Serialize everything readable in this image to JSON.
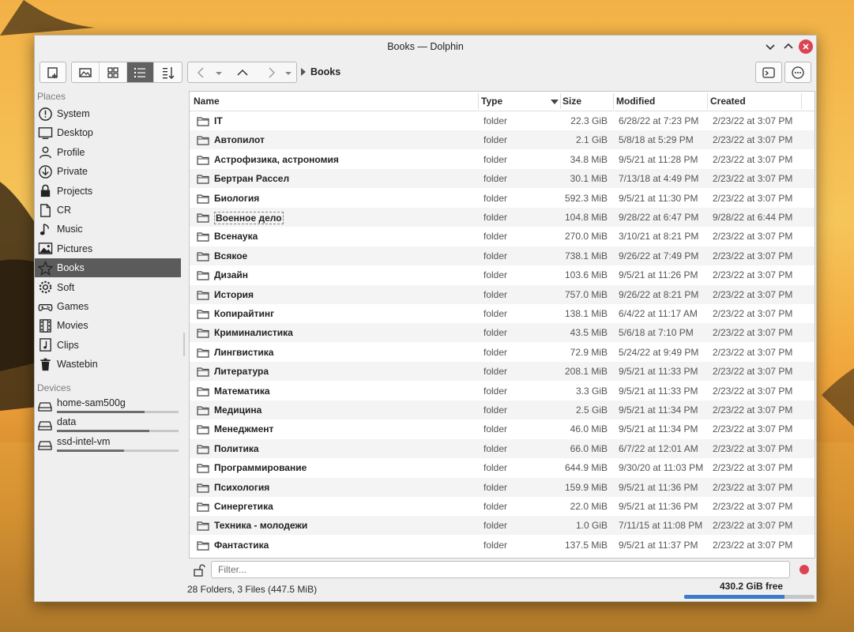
{
  "window": {
    "title": "Books — Dolphin"
  },
  "toolbar": {
    "breadcrumb": "Books",
    "icons": [
      "new-window-icon",
      "preview-icon",
      "icons-view-icon",
      "details-view-icon",
      "sort-icon",
      "back-icon",
      "history-icon",
      "up-icon",
      "forward-icon",
      "terminal-icon",
      "menu-icon"
    ]
  },
  "sidebar": {
    "places_title": "Places",
    "places": [
      {
        "label": "System",
        "icon": "info-icon"
      },
      {
        "label": "Desktop",
        "icon": "desktop-icon"
      },
      {
        "label": "Profile",
        "icon": "user-icon"
      },
      {
        "label": "Private",
        "icon": "download-icon"
      },
      {
        "label": "Projects",
        "icon": "lock-icon"
      },
      {
        "label": "CR",
        "icon": "document-icon"
      },
      {
        "label": "Music",
        "icon": "music-icon"
      },
      {
        "label": "Pictures",
        "icon": "picture-icon"
      },
      {
        "label": "Books",
        "icon": "star-icon",
        "selected": true
      },
      {
        "label": "Soft",
        "icon": "gear-icon"
      },
      {
        "label": "Games",
        "icon": "gamepad-icon"
      },
      {
        "label": "Movies",
        "icon": "film-icon"
      },
      {
        "label": "Clips",
        "icon": "clip-icon"
      },
      {
        "label": "Wastebin",
        "icon": "trash-icon"
      }
    ],
    "devices_title": "Devices",
    "devices": [
      {
        "label": "home-sam500g",
        "used_fraction": 0.72
      },
      {
        "label": "data",
        "used_fraction": 0.76
      },
      {
        "label": "ssd-intel-vm",
        "used_fraction": 0.55
      }
    ]
  },
  "columns": {
    "name": "Name",
    "type": "Type",
    "size": "Size",
    "modified": "Modified",
    "created": "Created"
  },
  "files": [
    {
      "name": "IT",
      "type": "folder",
      "size": "22.3 GiB",
      "modified": "6/28/22 at 7:23 PM",
      "created": "2/23/22 at 3:07 PM"
    },
    {
      "name": "Автопилот",
      "type": "folder",
      "size": "2.1 GiB",
      "modified": "5/8/18 at 5:29 PM",
      "created": "2/23/22 at 3:07 PM"
    },
    {
      "name": "Астрофизика, астрономия",
      "type": "folder",
      "size": "34.8 MiB",
      "modified": "9/5/21 at 11:28 PM",
      "created": "2/23/22 at 3:07 PM"
    },
    {
      "name": "Бертран Рассел",
      "type": "folder",
      "size": "30.1 MiB",
      "modified": "7/13/18 at 4:49 PM",
      "created": "2/23/22 at 3:07 PM"
    },
    {
      "name": "Биология",
      "type": "folder",
      "size": "592.3 MiB",
      "modified": "9/5/21 at 11:30 PM",
      "created": "2/23/22 at 3:07 PM"
    },
    {
      "name": "Военное дело",
      "type": "folder",
      "size": "104.8 MiB",
      "modified": "9/28/22 at 6:47 PM",
      "created": "9/28/22 at 6:44 PM",
      "focused": true
    },
    {
      "name": "Всенаука",
      "type": "folder",
      "size": "270.0 MiB",
      "modified": "3/10/21 at 8:21 PM",
      "created": "2/23/22 at 3:07 PM"
    },
    {
      "name": "Всякое",
      "type": "folder",
      "size": "738.1 MiB",
      "modified": "9/26/22 at 7:49 PM",
      "created": "2/23/22 at 3:07 PM"
    },
    {
      "name": "Дизайн",
      "type": "folder",
      "size": "103.6 MiB",
      "modified": "9/5/21 at 11:26 PM",
      "created": "2/23/22 at 3:07 PM"
    },
    {
      "name": "История",
      "type": "folder",
      "size": "757.0 MiB",
      "modified": "9/26/22 at 8:21 PM",
      "created": "2/23/22 at 3:07 PM"
    },
    {
      "name": "Копирайтинг",
      "type": "folder",
      "size": "138.1 MiB",
      "modified": "6/4/22 at 11:17 AM",
      "created": "2/23/22 at 3:07 PM"
    },
    {
      "name": "Криминалистика",
      "type": "folder",
      "size": "43.5 MiB",
      "modified": "5/6/18 at 7:10 PM",
      "created": "2/23/22 at 3:07 PM"
    },
    {
      "name": "Лингвистика",
      "type": "folder",
      "size": "72.9 MiB",
      "modified": "5/24/22 at 9:49 PM",
      "created": "2/23/22 at 3:07 PM"
    },
    {
      "name": "Литература",
      "type": "folder",
      "size": "208.1 MiB",
      "modified": "9/5/21 at 11:33 PM",
      "created": "2/23/22 at 3:07 PM"
    },
    {
      "name": "Математика",
      "type": "folder",
      "size": "3.3 GiB",
      "modified": "9/5/21 at 11:33 PM",
      "created": "2/23/22 at 3:07 PM"
    },
    {
      "name": "Медицина",
      "type": "folder",
      "size": "2.5 GiB",
      "modified": "9/5/21 at 11:34 PM",
      "created": "2/23/22 at 3:07 PM"
    },
    {
      "name": "Менеджмент",
      "type": "folder",
      "size": "46.0 MiB",
      "modified": "9/5/21 at 11:34 PM",
      "created": "2/23/22 at 3:07 PM"
    },
    {
      "name": "Политика",
      "type": "folder",
      "size": "66.0 MiB",
      "modified": "6/7/22 at 12:01 AM",
      "created": "2/23/22 at 3:07 PM"
    },
    {
      "name": "Программирование",
      "type": "folder",
      "size": "644.9 MiB",
      "modified": "9/30/20 at 11:03 PM",
      "created": "2/23/22 at 3:07 PM"
    },
    {
      "name": "Психология",
      "type": "folder",
      "size": "159.9 MiB",
      "modified": "9/5/21 at 11:36 PM",
      "created": "2/23/22 at 3:07 PM"
    },
    {
      "name": "Синергетика",
      "type": "folder",
      "size": "22.0 MiB",
      "modified": "9/5/21 at 11:36 PM",
      "created": "2/23/22 at 3:07 PM"
    },
    {
      "name": "Техника - молодежи",
      "type": "folder",
      "size": "1.0 GiB",
      "modified": "7/11/15 at 11:08 PM",
      "created": "2/23/22 at 3:07 PM"
    },
    {
      "name": "Фантастика",
      "type": "folder",
      "size": "137.5 MiB",
      "modified": "9/5/21 at 11:37 PM",
      "created": "2/23/22 at 3:07 PM"
    }
  ],
  "filter": {
    "placeholder": "Filter..."
  },
  "status": {
    "summary": "28 Folders, 3 Files (447.5 MiB)",
    "free": "430.2 GiB free",
    "used_fraction": 0.77
  },
  "colors": {
    "accent": "#3d7ac8",
    "selected": "#5b5b5b",
    "close": "#da4453"
  }
}
